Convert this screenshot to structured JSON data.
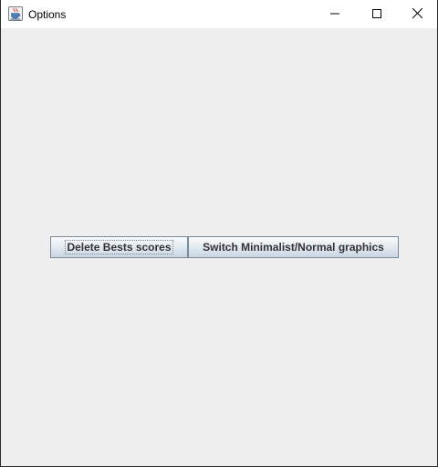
{
  "window": {
    "title": "Options",
    "icon": "java-coffee-cup-icon",
    "controls": {
      "minimize_icon": "minimize-icon",
      "maximize_icon": "maximize-icon",
      "close_icon": "close-icon"
    }
  },
  "buttons": {
    "delete_bests": "Delete Bests scores",
    "switch_graphics": "Switch Minimalist/Normal graphics"
  },
  "colors": {
    "content_background": "#eeeeee",
    "button_border": "#7a8a99",
    "button_text": "#333333"
  }
}
